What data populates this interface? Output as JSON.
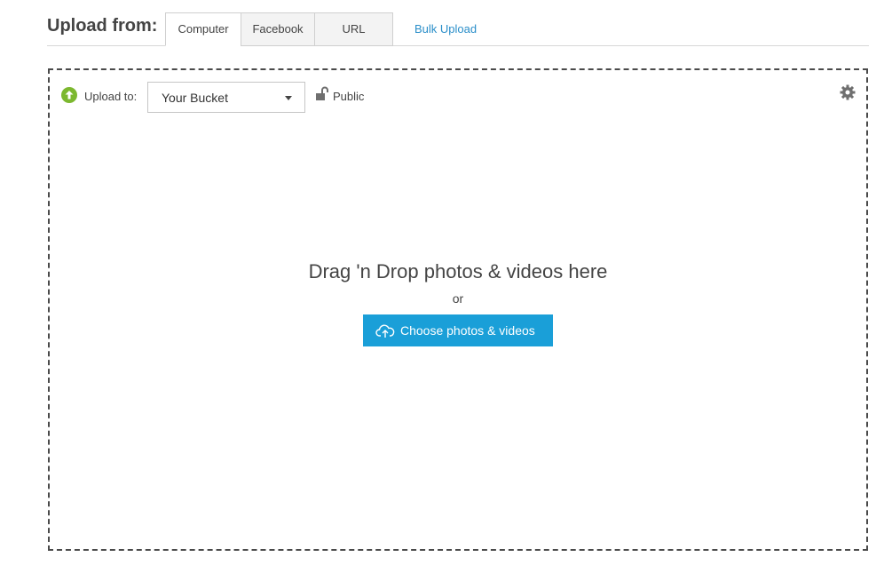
{
  "header": {
    "title": "Upload from:",
    "tabs": [
      {
        "label": "Computer",
        "active": true
      },
      {
        "label": "Facebook",
        "active": false
      },
      {
        "label": "URL",
        "active": false
      }
    ],
    "bulk_upload_label": "Bulk Upload"
  },
  "dropzone": {
    "upload_to_label": "Upload to:",
    "upload_to_icon": "upload-arrow-circle-icon",
    "bucket_select": {
      "value": "Your Bucket"
    },
    "privacy": {
      "label": "Public",
      "icon": "unlock-icon"
    },
    "settings_icon": "gear-icon",
    "title": "Drag 'n Drop photos & videos here",
    "or_text": "or",
    "choose_button": {
      "label": "Choose photos & videos",
      "icon": "cloud-upload-icon"
    }
  },
  "colors": {
    "accent_blue": "#1a9fd8",
    "link_blue": "#2a8ec9",
    "upload_green": "#7cb82f",
    "icon_gray": "#6f6f6f"
  }
}
